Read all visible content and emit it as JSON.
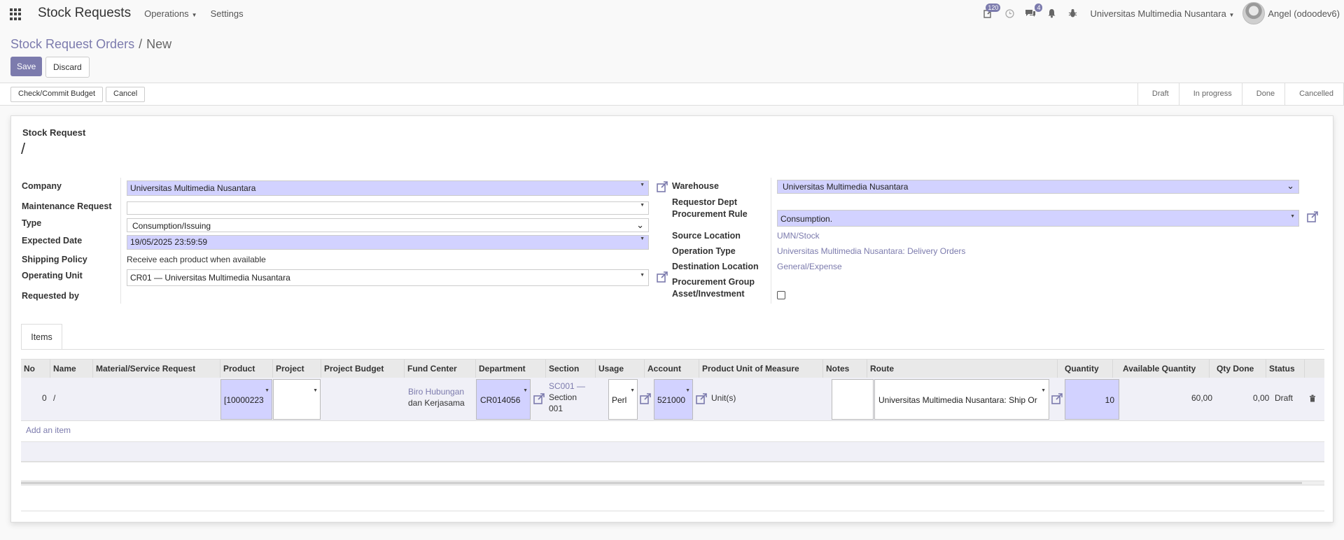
{
  "app": {
    "title": "Stock Requests"
  },
  "nav": {
    "menus": [
      {
        "label": "Operations"
      },
      {
        "label": "Settings"
      }
    ],
    "badges": {
      "activity": "120",
      "messages": "4"
    },
    "company": "Universitas Multimedia Nusantara",
    "user": "Angel (odoodev6)"
  },
  "breadcrumb": {
    "parent": "Stock Request Orders",
    "current": "New"
  },
  "buttons": {
    "save": "Save",
    "discard": "Discard",
    "check_budget": "Check/Commit Budget",
    "cancel": "Cancel"
  },
  "stages": [
    "Draft",
    "In progress",
    "Done",
    "Cancelled"
  ],
  "form": {
    "title_label": "Stock Request",
    "name": "/",
    "left": {
      "company": {
        "label": "Company",
        "value": "Universitas Multimedia Nusantara"
      },
      "maintenance": {
        "label": "Maintenance Request",
        "value": ""
      },
      "type": {
        "label": "Type",
        "value": "Consumption/Issuing"
      },
      "expected_date": {
        "label": "Expected Date",
        "value": "19/05/2025 23:59:59"
      },
      "shipping_policy": {
        "label": "Shipping Policy",
        "value": "Receive each product when available"
      },
      "operating_unit": {
        "label": "Operating Unit",
        "value": "CR01 — Universitas Multimedia Nusantara"
      },
      "requested_by": {
        "label": "Requested by",
        "value": ""
      }
    },
    "right": {
      "warehouse": {
        "label": "Warehouse",
        "value": "Universitas Multimedia Nusantara"
      },
      "requestor_dept": {
        "label": "Requestor Dept"
      },
      "procurement_rule": {
        "label": "Procurement Rule",
        "value": "Consumption."
      },
      "source_location": {
        "label": "Source Location",
        "value": "UMN/Stock"
      },
      "operation_type": {
        "label": "Operation Type",
        "value": "Universitas Multimedia Nusantara: Delivery Orders"
      },
      "destination_location": {
        "label": "Destination Location",
        "value": "General/Expense"
      },
      "procurement_group": {
        "label": "Procurement Group"
      },
      "asset_investment": {
        "label": "Asset/Investment",
        "checked": false
      }
    }
  },
  "tabs": [
    {
      "label": "Items"
    }
  ],
  "table": {
    "headers": {
      "no": "No",
      "name": "Name",
      "material": "Material/Service Request",
      "product": "Product",
      "project": "Project",
      "project_budget": "Project Budget",
      "fund_center": "Fund Center",
      "department": "Department",
      "section": "Section",
      "usage": "Usage",
      "account": "Account",
      "uom": "Product Unit of Measure",
      "notes": "Notes",
      "route": "Route",
      "quantity": "Quantity",
      "available": "Available Quantity",
      "qty_done": "Qty Done",
      "status": "Status"
    },
    "rows": [
      {
        "no": "0",
        "name": "/",
        "product": "[10000223",
        "project": "",
        "fund_center_line1": "Biro Hubungan",
        "fund_center_line2": "dan Kerjasama",
        "department": "CR014056",
        "section_line1": "SC001 —",
        "section_line2": "Section",
        "section_line3": "001",
        "usage": "Perl",
        "account": "521000",
        "uom": "Unit(s)",
        "notes": "",
        "route": "Universitas Multimedia Nusantara: Ship Or",
        "quantity": "10",
        "available": "60,00",
        "qty_done": "0,00",
        "status": "Draft"
      }
    ],
    "add_item": "Add an item"
  },
  "colors": {
    "primary": "#7c7bad",
    "required_bg": "#d2d2ff"
  },
  "icons": {
    "apps": "apps-grid-icon",
    "external": "external-link-icon",
    "delete": "trash-icon"
  }
}
